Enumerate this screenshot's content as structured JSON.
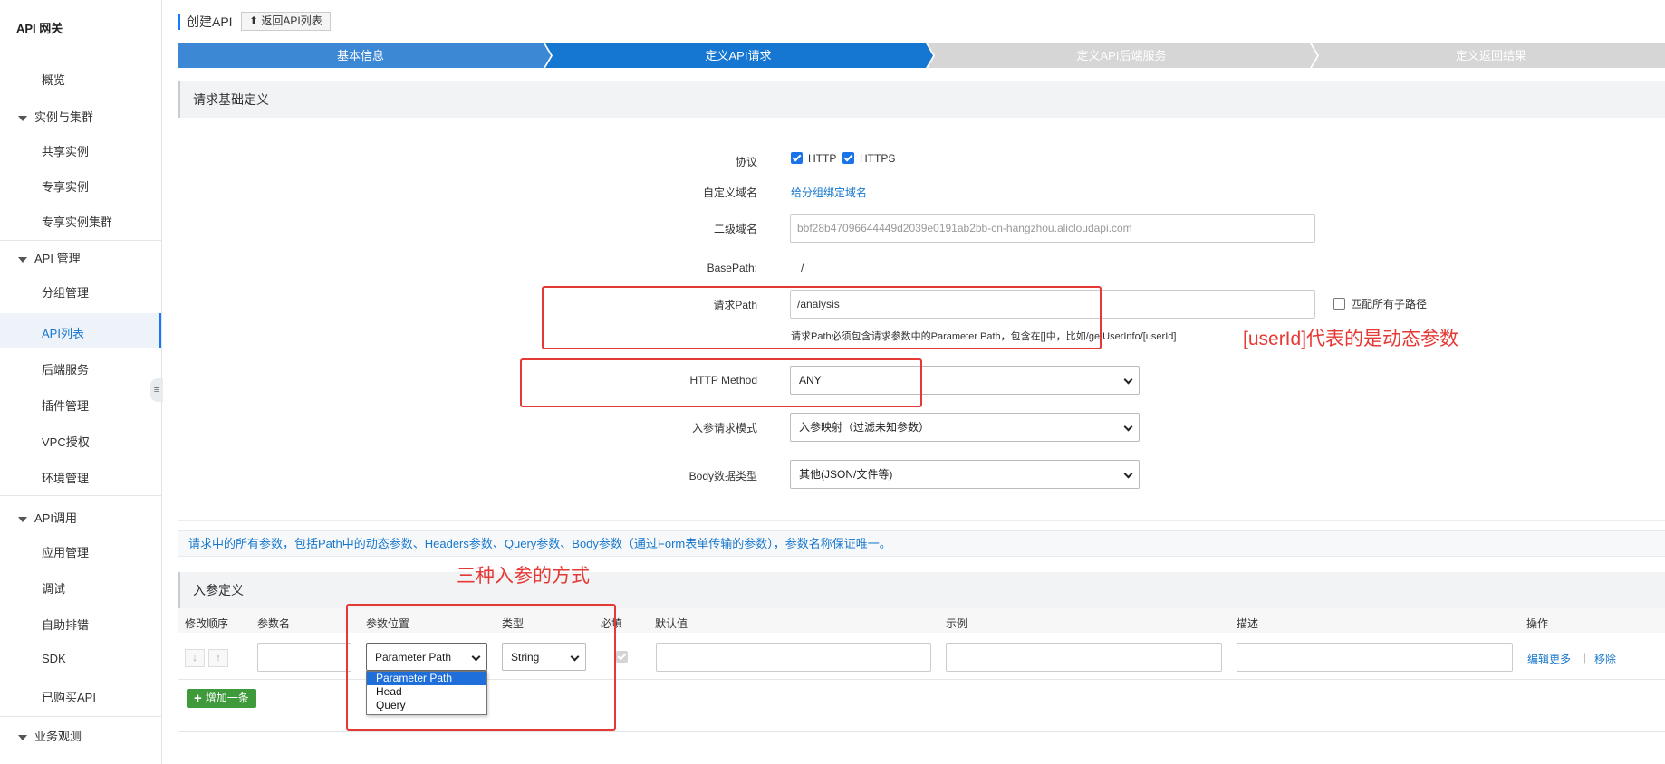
{
  "sidebar": {
    "brand": "API 网关",
    "overview": "概览",
    "groups": [
      {
        "label": "实例与集群",
        "items": [
          "共享实例",
          "专享实例",
          "专享实例集群"
        ]
      },
      {
        "label": "API 管理",
        "items": [
          "分组管理",
          "API列表",
          "后端服务",
          "插件管理",
          "VPC授权",
          "环境管理"
        ]
      },
      {
        "label": "API调用",
        "items": [
          "应用管理",
          "调试",
          "自助排错",
          "SDK",
          "已购买API"
        ]
      },
      {
        "label": "业务观测",
        "items": []
      }
    ],
    "active_item": "API列表"
  },
  "header": {
    "title": "创建API",
    "back_label": "返回API列表"
  },
  "steps": [
    {
      "label": "基本信息",
      "state": "done"
    },
    {
      "label": "定义API请求",
      "state": "active"
    },
    {
      "label": "定义API后端服务",
      "state": "pending"
    },
    {
      "label": "定义返回结果",
      "state": "pending"
    }
  ],
  "section_request": {
    "title": "请求基础定义",
    "protocol_label": "协议",
    "protocol_options": [
      {
        "label": "HTTP",
        "checked": true
      },
      {
        "label": "HTTPS",
        "checked": true
      }
    ],
    "custom_domain_label": "自定义域名",
    "custom_domain_link": "给分组绑定域名",
    "subdomain_label": "二级域名",
    "subdomain_value": "bbf28b47096644449d2039e0191ab2bb-cn-hangzhou.alicloudapi.com",
    "basepath_label": "BasePath:",
    "basepath_value": "/",
    "path_label": "请求Path",
    "path_value": "/analysis",
    "match_subpath_label": "匹配所有子路径",
    "match_subpath_checked": false,
    "path_hint": "请求Path必须包含请求参数中的Parameter Path，包含在[]中，比如/getUserInfo/[userId]",
    "method_label": "HTTP Method",
    "method_value": "ANY",
    "param_mode_label": "入参请求模式",
    "param_mode_value": "入参映射（过滤未知参数）",
    "body_type_label": "Body数据类型",
    "body_type_value": "其他(JSON/文件等)"
  },
  "info_bar": "请求中的所有参数，包括Path中的动态参数、Headers参数、Query参数、Body参数（通过Form表单传输的参数），参数名称保证唯一。",
  "params_section": {
    "title": "入参定义",
    "columns": [
      "修改顺序",
      "参数名",
      "参数位置",
      "类型",
      "必填",
      "默认值",
      "示例",
      "描述",
      "操作"
    ],
    "row": {
      "position": "Parameter Path",
      "type": "String",
      "required": true,
      "actions": [
        "编辑更多",
        "移除"
      ]
    },
    "position_options": [
      "Parameter Path",
      "Head",
      "Query"
    ],
    "add_label": "增加一条"
  },
  "annotations": {
    "userid_note": "[userId]代表的是动态参数",
    "three_ways_note": "三种入参的方式"
  },
  "colors": {
    "step_active": "#1677d2",
    "step_done": "#3d88d4",
    "step_pending": "#d6d6d6",
    "annotation": "#e53935",
    "link": "#1677cc"
  }
}
